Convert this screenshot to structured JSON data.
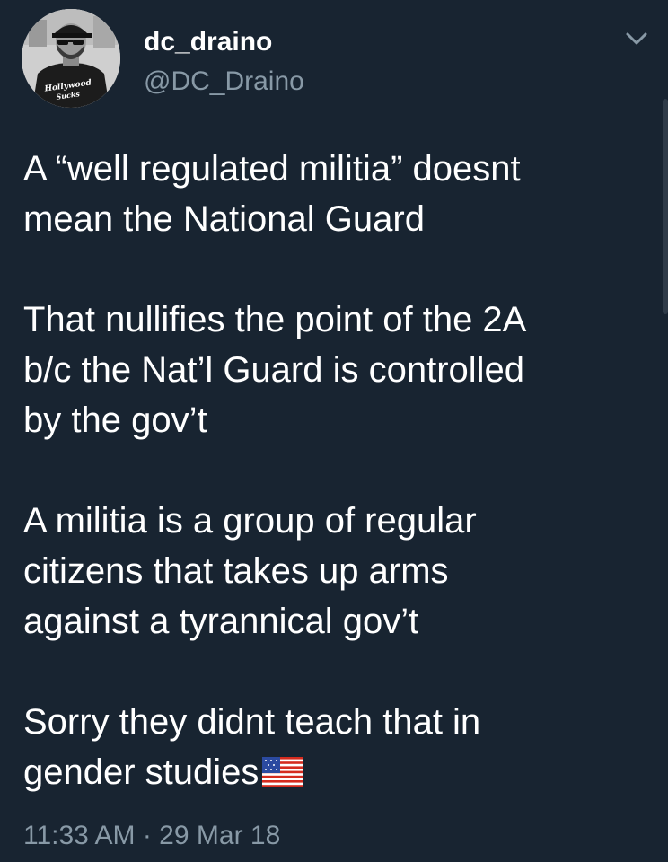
{
  "user": {
    "display_name": "dc_draino",
    "handle": "@DC_Draino",
    "avatar_shirt_text": "Hollywood Sucks"
  },
  "tweet": {
    "paragraphs": [
      {
        "lines": [
          "A “well regulated militia” doesnt",
          "mean the National Guard"
        ]
      },
      {
        "lines": [
          "That nullifies the point of the 2A",
          "b/c the Nat’l Guard is controlled",
          "by the gov’t"
        ]
      },
      {
        "lines": [
          "A militia is a group of regular",
          "citizens that takes up arms",
          "against a tyrannical gov’t"
        ]
      },
      {
        "lines": [
          "Sorry they didnt teach that in",
          "gender studies"
        ]
      }
    ],
    "timestamp": "11:33 AM · 29 Mar 18",
    "trailing_emoji": "us-flag-icon"
  },
  "colors": {
    "background": "#182431",
    "text": "#ffffff",
    "secondary_text": "#8899a6"
  }
}
